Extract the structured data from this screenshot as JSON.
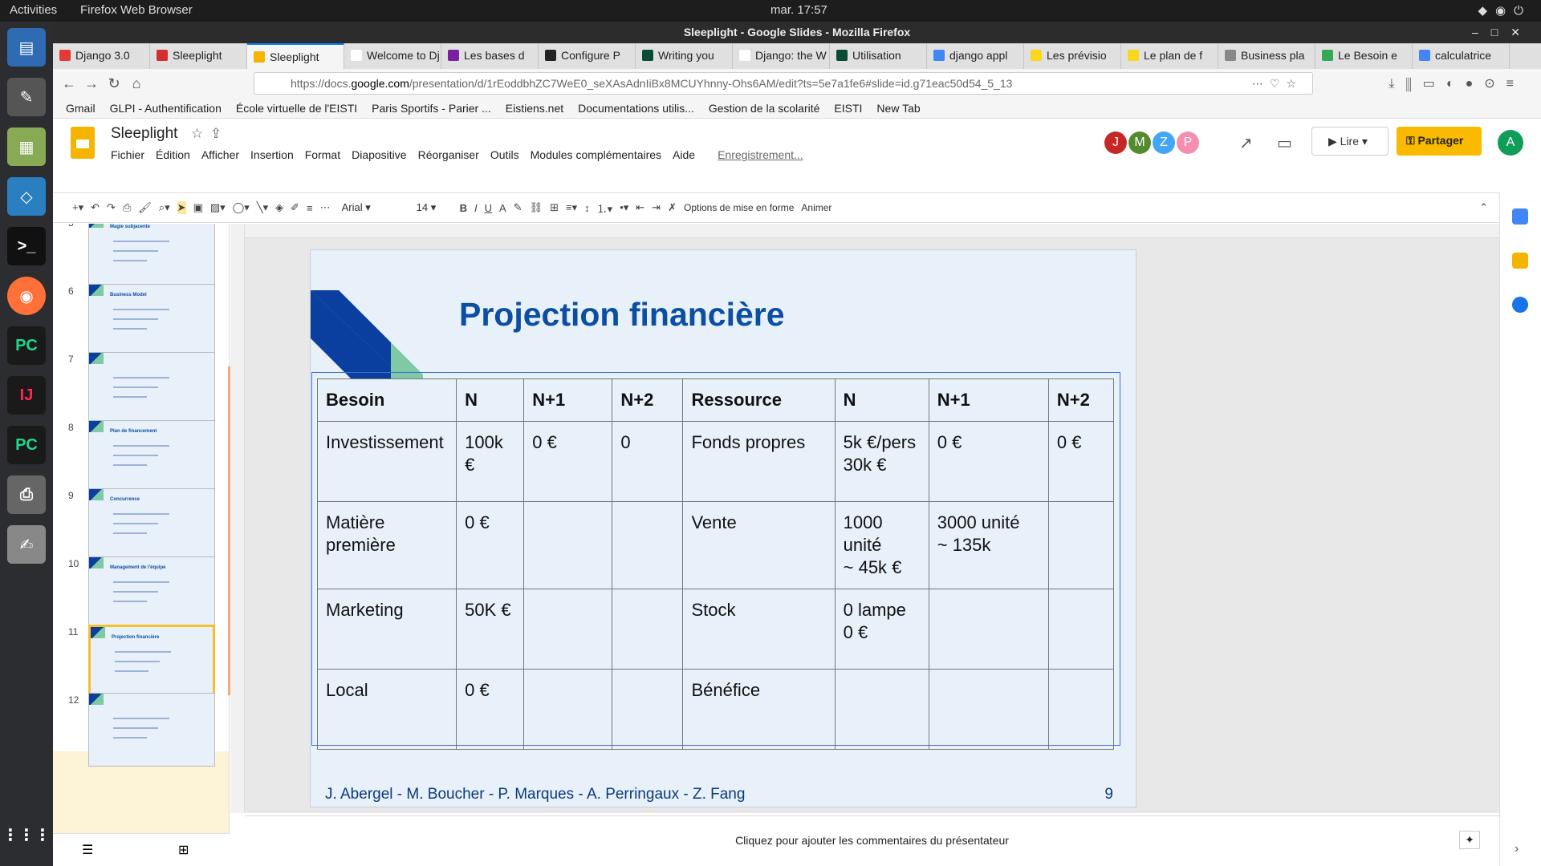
{
  "os": {
    "activities": "Activities",
    "app_menu": "Firefox Web Browser",
    "clock": "mar. 17:57"
  },
  "window": {
    "title": "Sleeplight - Google Slides - Mozilla Firefox"
  },
  "tabs": [
    {
      "label": "Django 3.0",
      "color": "#e53935"
    },
    {
      "label": "Sleeplight",
      "color": "#d32f2f"
    },
    {
      "label": "Sleeplight",
      "color": "#f4b400",
      "active": true
    },
    {
      "label": "Welcome to Dj",
      "color": "#ffffff"
    },
    {
      "label": "Les bases d",
      "color": "#7b1fa2"
    },
    {
      "label": "Configure P",
      "color": "#222222"
    },
    {
      "label": "Writing you",
      "color": "#0c4b33"
    },
    {
      "label": "Django: the W",
      "color": "#ffffff"
    },
    {
      "label": "Utilisation",
      "color": "#0c4b33"
    },
    {
      "label": "django appl",
      "color": "#4285f4"
    },
    {
      "label": "Les prévisio",
      "color": "#f9d71c"
    },
    {
      "label": "Le plan de f",
      "color": "#f9d71c"
    },
    {
      "label": "Business pla",
      "color": "#888888"
    },
    {
      "label": "Le Besoin e",
      "color": "#34a853"
    },
    {
      "label": "calculatrice",
      "color": "#4285f4"
    }
  ],
  "url": {
    "prefix": "https://docs.",
    "domain": "google.com",
    "path": "/presentation/d/1rEoddbhZC7WeE0_seXAsAdnIiBx8MCUYhnny-Ohs6AM/edit?ts=5e7a1fe6#slide=id.g71eac50d54_5_13"
  },
  "bookmarks": [
    "Gmail",
    "GLPI - Authentification",
    "École virtuelle de l'EISTI",
    "Paris Sportifs - Parier ...",
    "Eistiens.net",
    "Documentations utilis...",
    "Gestion de la scolarité",
    "EISTI",
    "New Tab"
  ],
  "slides_app": {
    "doc_title": "Sleeplight",
    "menus": [
      "Fichier",
      "Édition",
      "Afficher",
      "Insertion",
      "Format",
      "Diapositive",
      "Réorganiser",
      "Outils",
      "Modules complémentaires",
      "Aide"
    ],
    "saving": "Enregistrement...",
    "collaborators": [
      {
        "initial": "J",
        "color": "#c62828"
      },
      {
        "initial": "M",
        "color": "#558b2f"
      },
      {
        "initial": "Z",
        "color": "#42a5f5"
      },
      {
        "initial": "P",
        "color": "#f48fb1"
      }
    ],
    "present_label": "Lire",
    "share_label": "Partager",
    "user_initial": "A",
    "toolbar": {
      "font": "Arial",
      "size": "14",
      "format_options": "Options de mise en forme",
      "animate": "Animer"
    }
  },
  "filmstrip": [
    {
      "num": "5",
      "title": "Magie subjacente"
    },
    {
      "num": "6",
      "title": "Business Model"
    },
    {
      "num": "7",
      "title": ""
    },
    {
      "num": "8",
      "title": "Plan de financement"
    },
    {
      "num": "9",
      "title": "Concurrence"
    },
    {
      "num": "10",
      "title": "Management de l'équipe"
    },
    {
      "num": "11",
      "title": "Projection financière",
      "selected": true
    },
    {
      "num": "12",
      "title": ""
    }
  ],
  "slide": {
    "title": "Projection financière",
    "table": {
      "headers": [
        "Besoin",
        "N",
        "N+1",
        "N+2",
        "Ressource",
        "N",
        "N+1",
        "N+2"
      ],
      "rows": [
        [
          "Investissement",
          "100k €",
          "0 €",
          "0",
          "Fonds propres",
          "5k €/pers\n30k €",
          "0 €",
          "0 €"
        ],
        [
          "Matière première",
          "0 €",
          "",
          "",
          "Vente",
          "1000 unité\n~ 45k €",
          "3000 unité\n~ 135k",
          ""
        ],
        [
          "Marketing",
          "50K €",
          "",
          "",
          "Stock",
          "0 lampe\n0 €",
          "",
          ""
        ],
        [
          "Local",
          "0 €",
          "",
          "",
          "Bénéfice",
          "",
          "",
          ""
        ]
      ]
    },
    "footer_names": "J.  Abergel - M. Boucher - P. Marques - A. Perringaux - Z. Fang",
    "page_number": "9"
  },
  "notes_placeholder": "Cliquez pour ajouter les commentaires du présentateur"
}
